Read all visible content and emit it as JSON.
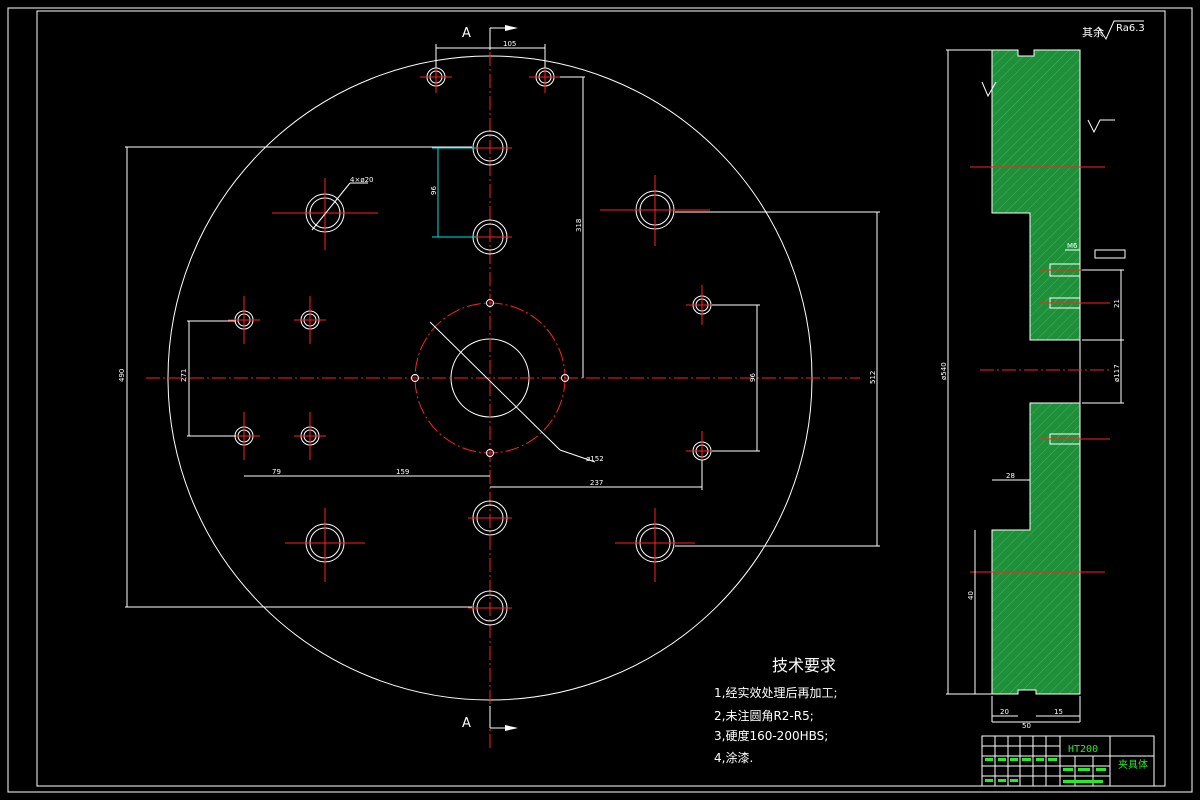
{
  "section": {
    "label_top": "A",
    "label_bottom": "A"
  },
  "roughness": {
    "prefix": "其余",
    "value": "Ra6.3"
  },
  "technical_requirements": {
    "title": "技术要求",
    "items": [
      "1,经实效处理后再加工;",
      "2,未注圆角R2-R5;",
      "3,硬度160-200HBS;",
      "4,涂漆."
    ]
  },
  "title_block": {
    "material": "HT200",
    "part_name": "夹具体"
  },
  "dimensions": {
    "top_span": "105",
    "vertical_96": "96",
    "right_vertical": "318",
    "outer_left": "490",
    "inner_left": "271",
    "right_inner": "96",
    "right_outer": "512",
    "bottom_left": "79",
    "bottom_mid": "159",
    "bottom_right": "237",
    "center_dia": "ø152",
    "hole_dia": "4×ø20",
    "side_height": "ø540",
    "side_bore": "ø117",
    "side_right": "21",
    "side_top_small": "M6",
    "side_shoulder": "28",
    "side_lower": "40",
    "side_bottom_left": "20",
    "side_bottom_total": "50",
    "side_bottom_right": "15"
  },
  "colors": {
    "outline": "#ffffff",
    "centerline": "#ff2020",
    "dimension_blue": "#00e5e5",
    "hatch": "#1f8f3a",
    "text_green": "#22ee22"
  }
}
